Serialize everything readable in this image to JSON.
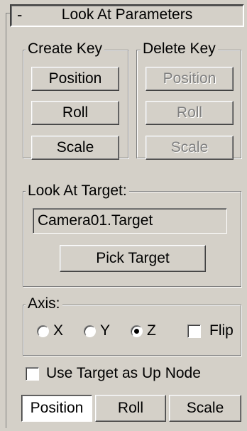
{
  "rollout": {
    "toggle_symbol": "-",
    "title": "Look At Parameters"
  },
  "create_key": {
    "label": "Create Key",
    "buttons": [
      "Position",
      "Roll",
      "Scale"
    ]
  },
  "delete_key": {
    "label": "Delete Key",
    "buttons": [
      "Position",
      "Roll",
      "Scale"
    ],
    "enabled": false
  },
  "look_at_target": {
    "label": "Look At Target:",
    "value": "Camera01.Target",
    "pick_button": "Pick Target"
  },
  "axis": {
    "label": "Axis:",
    "options": [
      "X",
      "Y",
      "Z"
    ],
    "selected": "Z",
    "flip_label": "Flip",
    "flip_checked": false
  },
  "use_target_up": {
    "label": "Use Target as Up Node",
    "checked": false
  },
  "mode_tabs": {
    "items": [
      "Position",
      "Roll",
      "Scale"
    ],
    "active": "Position"
  },
  "colors": {
    "panel": "#d4d0c8",
    "disabled_text": "#808080"
  }
}
